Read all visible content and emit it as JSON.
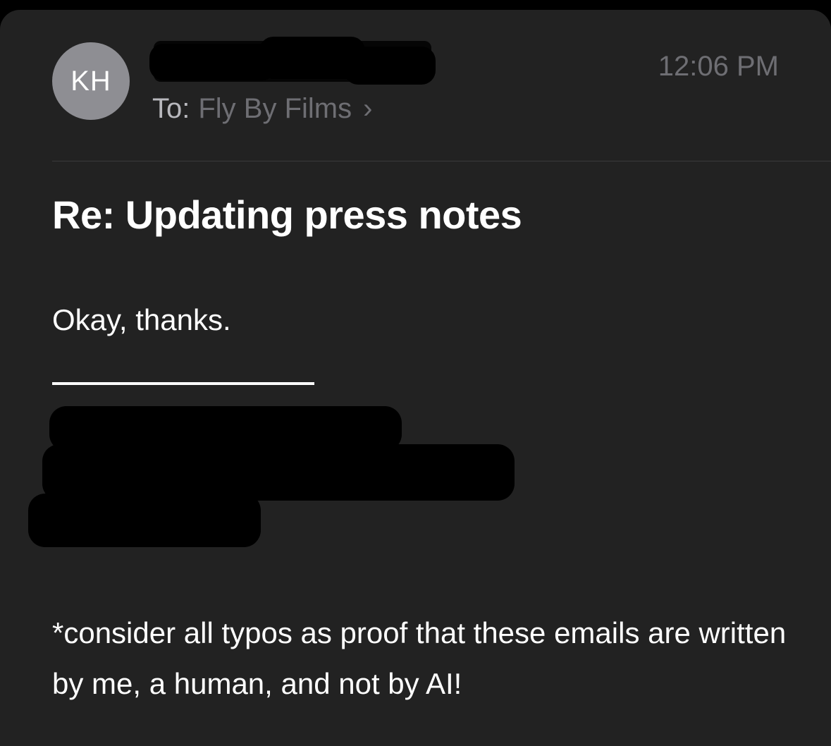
{
  "message": {
    "avatar_initials": "KH",
    "time": "12:06 PM",
    "to_label": "To:",
    "to_name": "Fly By Films",
    "chevron": "›",
    "subject": "Re: Updating press notes",
    "body": "Okay, thanks.",
    "footnote": "*consider all typos as proof that these emails are written by me, a human, and not by AI!"
  },
  "colors": {
    "background": "#222222",
    "avatar": "#8e8e93",
    "secondary_text": "#6e6e73",
    "primary_text": "#ffffff"
  }
}
